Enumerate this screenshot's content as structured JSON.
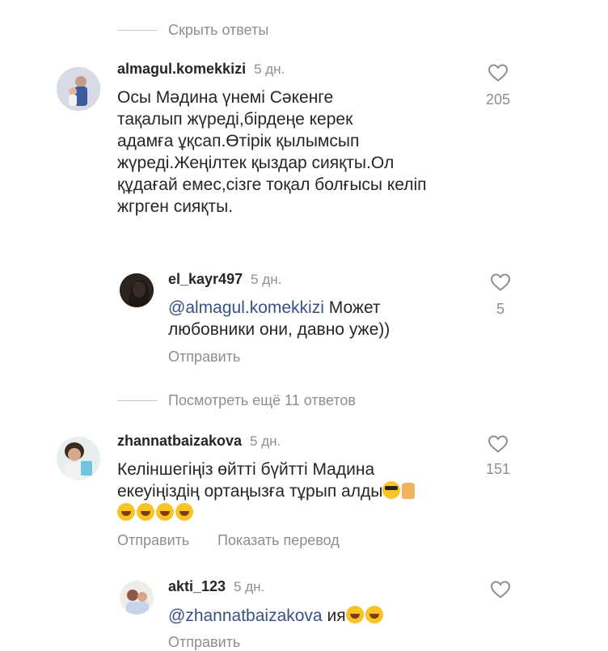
{
  "hide_replies": "Скрыть ответы",
  "view_more_replies": "Посмотреть ещё 11 ответов",
  "comments": [
    {
      "username": "almagul.komekkizi",
      "time": "5 дн.",
      "lines": [
        "Осы Мәдина үнемі Сәкенге",
        "тақалып жүреді,бірдеңе керек",
        "адамға ұқсап.Өтірік қылымсып",
        "жүреді.Жеңілтек қыздар сияқты.Ол",
        "құдағай емес,сізге тоқал болғысы келіп",
        "жгрген сияқты."
      ],
      "likes": "205"
    },
    {
      "username": "el_kayr497",
      "time": "5 дн.",
      "mention": "@almagul.komekkizi",
      "line1_rest": " Может",
      "line2": "любовники они, давно уже))",
      "likes": "5",
      "reply_label": "Отправить"
    },
    {
      "username": "zhannatbaizakova",
      "time": "5 дн.",
      "line1": "Келіншегіңіз өйтті бүйтті Мадина",
      "line2": "екеуіңіздің ортаңызға тұрып алды",
      "likes": "151",
      "reply_label": "Отправить",
      "translate_label": "Показать перевод"
    },
    {
      "username": "akti_123",
      "time": "5 дн.",
      "mention": "@zhannatbaizakova",
      "text_rest": " ия",
      "reply_label": "Отправить"
    }
  ],
  "icons": {
    "heart": "heart-icon",
    "emoji_laugh": "face-with-tears-of-joy-icon",
    "emoji_cool": "smiling-face-with-sunglasses-icon",
    "emoji_thumb": "thumbs-up-icon"
  }
}
